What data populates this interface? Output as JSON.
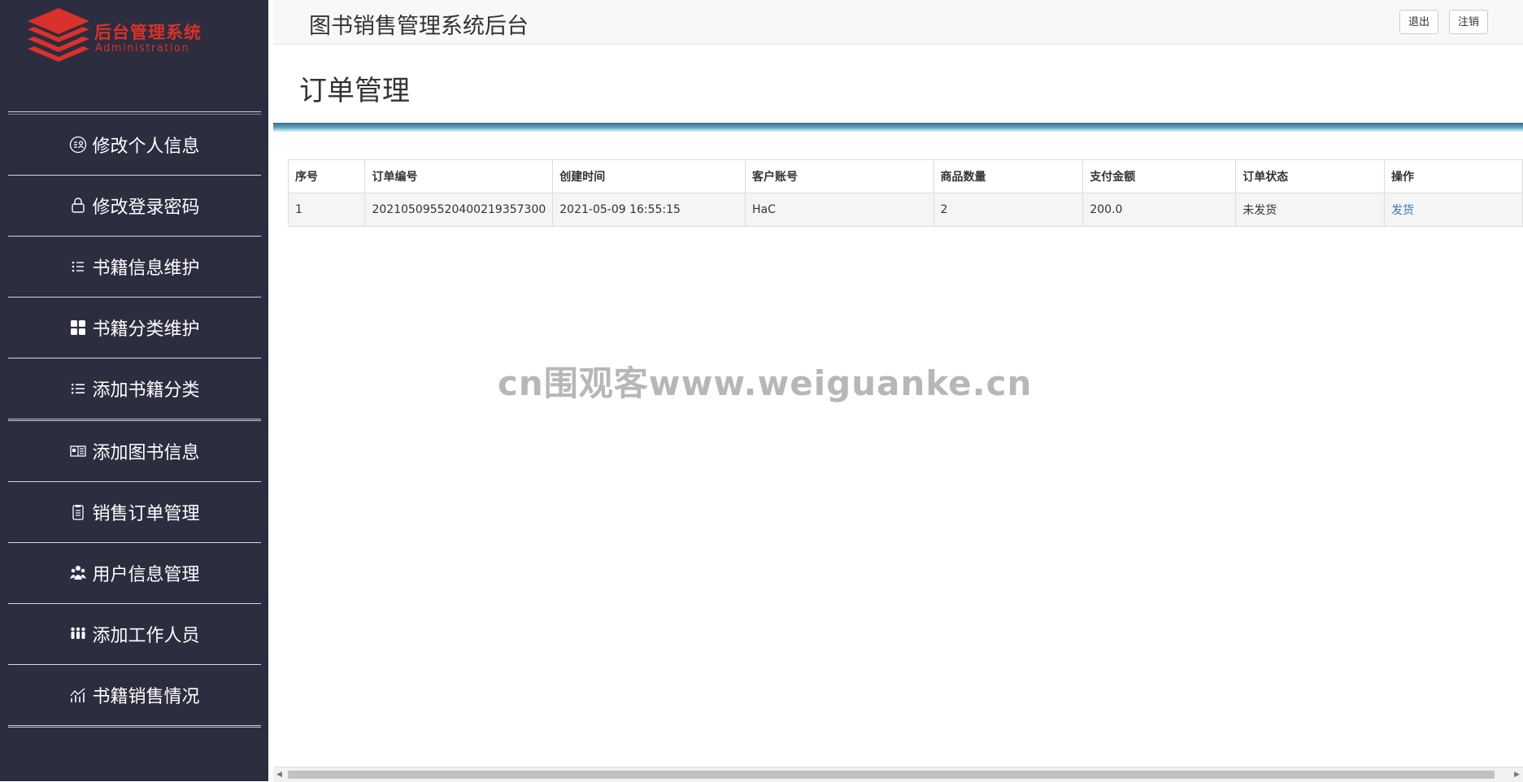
{
  "sidebar": {
    "logo": {
      "title": "后台管理系统",
      "subtitle": "Administration"
    },
    "items": [
      {
        "label": "修改个人信息",
        "icon": "user-edit-icon"
      },
      {
        "label": "修改登录密码",
        "icon": "lock-icon"
      },
      {
        "label": "书籍信息维护",
        "icon": "list-icon"
      },
      {
        "label": "书籍分类维护",
        "icon": "grid-icon"
      },
      {
        "label": "添加书籍分类",
        "icon": "list-add-icon"
      },
      {
        "label": "添加图书信息",
        "icon": "book-card-icon"
      },
      {
        "label": "销售订单管理",
        "icon": "clipboard-icon"
      },
      {
        "label": "用户信息管理",
        "icon": "users-icon"
      },
      {
        "label": "添加工作人员",
        "icon": "staff-icon"
      },
      {
        "label": "书籍销售情况",
        "icon": "chart-icon"
      }
    ]
  },
  "header": {
    "title": "图书销售管理系统后台",
    "logout_label": "退出",
    "cancel_label": "注销"
  },
  "page": {
    "heading": "订单管理"
  },
  "table": {
    "columns": [
      "序号",
      "订单编号",
      "创建时间",
      "客户账号",
      "商品数量",
      "支付金额",
      "订单状态",
      "操作"
    ],
    "rows": [
      {
        "index": "1",
        "order_no": "20210509552040021935730​0",
        "created": "2021-05-09 16:55:15",
        "account": "HaC",
        "quantity": "2",
        "amount": "200.0",
        "status": "未发货",
        "action": "发货"
      }
    ]
  },
  "watermark": "cn围观客www.weiguanke.cn",
  "colors": {
    "sidebar": "#2c2d3f",
    "accent": "#d9312b",
    "link": "#337ab7"
  }
}
